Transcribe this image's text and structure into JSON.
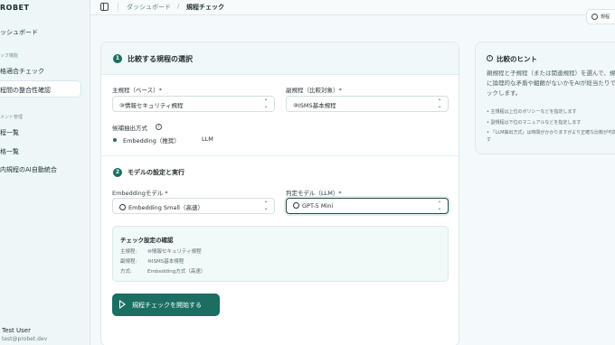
{
  "sidebar": {
    "brand": "ROBET",
    "items": [
      {
        "label": "ッシュボード"
      },
      {
        "section": "ック機能"
      },
      {
        "label": "格適合チェック"
      },
      {
        "label": "程間の整合性確認"
      },
      {
        "section": "メント管理"
      },
      {
        "label": "程一覧"
      },
      {
        "label": "格一覧"
      },
      {
        "label": "内規程のAI自動統合"
      }
    ],
    "user": {
      "name": "Test User",
      "email": "test@probet.dev"
    }
  },
  "header": {
    "breadcrumb_parent": "ダッシュボード",
    "breadcrumb_sep": "/",
    "breadcrumb_current": "規程チェック",
    "corner_chip": "規程"
  },
  "main": {
    "step1": {
      "number": "1",
      "title": "比較する規程の選択",
      "base_label": "主規程（ベース）*",
      "base_value": "⑩情報セキュリティ規程",
      "target_label": "副規程（比較対象）*",
      "target_value": "⑩ISMS基本規程",
      "method_label": "候補抽出方式",
      "methods": [
        "Embedding（推奨）",
        "LLM"
      ],
      "selected_method": "Embedding（推奨）"
    },
    "step2": {
      "number": "2",
      "title": "モデルの設定と実行",
      "embedding_label": "Embeddingモデル *",
      "embedding_value": "Embedding Small（高速）",
      "judge_label": "判定モデル（LLM）*",
      "judge_value": "GPT-5 Mini"
    },
    "confirm": {
      "title": "チェック設定の確認",
      "rows": [
        {
          "key": "主規程:",
          "value": "⑩情報セキュリティ規程"
        },
        {
          "key": "副規程:",
          "value": "⑩ISMS基本規程"
        },
        {
          "key": "方式:",
          "value": "Embedding方式（高速）"
        }
      ]
    },
    "start_button": "規程チェックを開始する"
  },
  "hints": {
    "title": "比較のヒント",
    "description": "親規程と子規程（または関連規程）を選んで、規程間に論理的な矛盾や齟齬がないかをAIが総当たりでチェックします。",
    "bullets": [
      "• 主規程は上位のポリシーなどを指定します",
      "• 副規程は下位のマニュアルなどを指定します",
      "• 「LLM抽出方式」は時間がかかりますがより正確な比較が可能です"
    ]
  },
  "colors": {
    "accent": "#1b6e62",
    "sidebar_bg": "#eef7f8",
    "page_bg": "#f4fafb"
  }
}
